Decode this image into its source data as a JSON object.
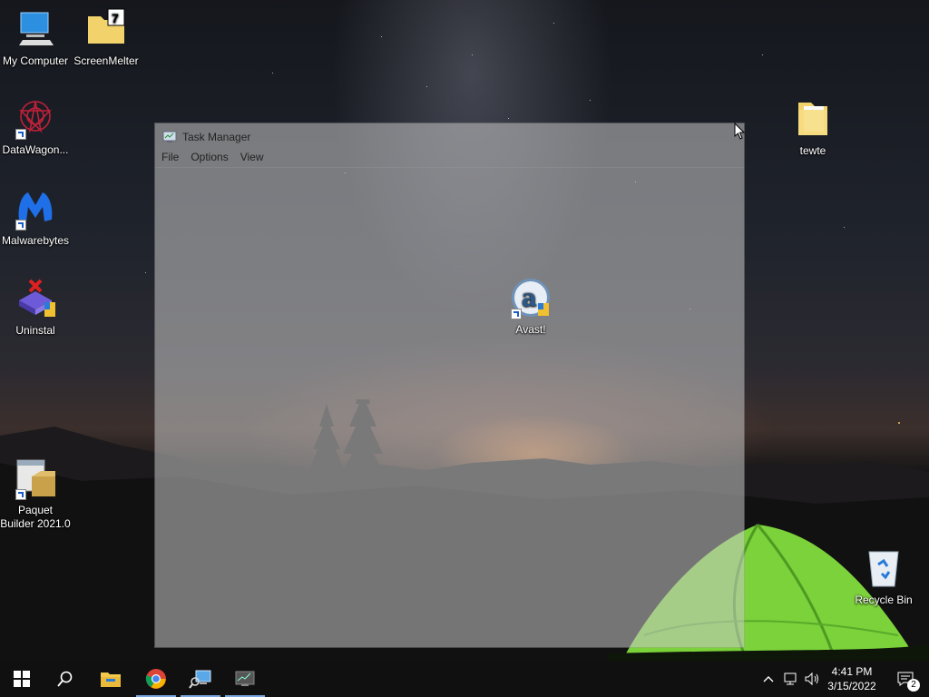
{
  "desktop": {
    "icons": [
      {
        "label": "My Computer",
        "icon": "computer-icon"
      },
      {
        "label": "ScreenMelter",
        "icon": "folder-icon"
      },
      {
        "label": "DataWagon...",
        "icon": "datawagon-icon"
      },
      {
        "label": "Malwarebytes",
        "icon": "malwarebytes-icon"
      },
      {
        "label": "Uninstal",
        "icon": "uninstall-icon"
      },
      {
        "label": "Paquet Builder 2021.0",
        "icon": "paquet-builder-icon"
      },
      {
        "label": "tewte",
        "icon": "folder-icon"
      },
      {
        "label": "Avast!",
        "icon": "avast-icon"
      },
      {
        "label": "Recycle Bin",
        "icon": "recycle-bin-icon"
      }
    ]
  },
  "task_manager": {
    "title": "Task Manager",
    "menu": [
      "File",
      "Options",
      "View"
    ]
  },
  "taskbar": {
    "pinned": [
      "start",
      "search",
      "file-explorer",
      "chrome",
      "network-app",
      "task-manager"
    ],
    "clock_time": "4:41 PM",
    "clock_date": "3/15/2022",
    "notification_count": "2"
  },
  "colors": {
    "taskbar": "#101010",
    "accent_underline": "#7aa7e0",
    "tent_green": "#7bd23a"
  }
}
